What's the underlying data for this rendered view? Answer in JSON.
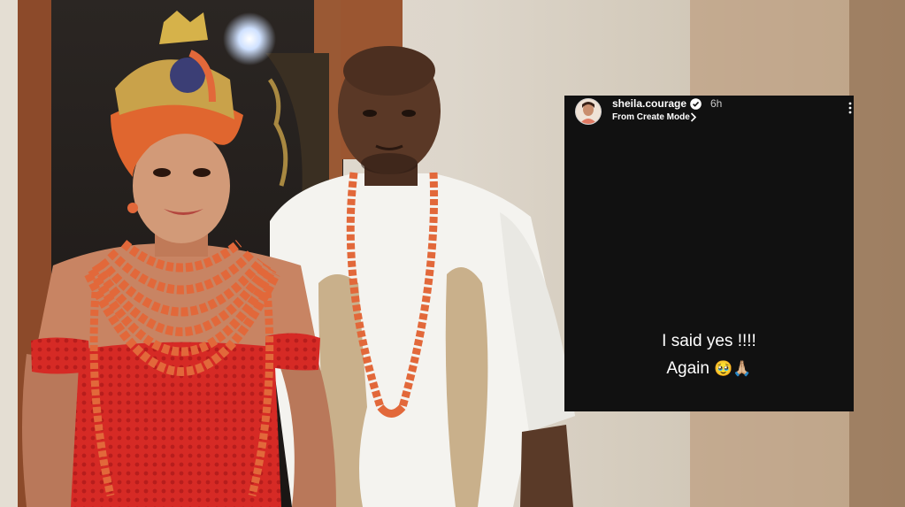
{
  "story": {
    "username": "sheila.courage",
    "time": "6h",
    "subtitle": "From Create Mode",
    "line1": "I said yes !!!!",
    "line2_text": "Again",
    "line2_emoji": "🥹🙏🏼"
  },
  "colors": {
    "story_background": "#111111",
    "coral_beads": "#e2683a",
    "dress_red": "#d62a25",
    "gele_orange": "#e0662f",
    "agbada_white": "#f4f3ef",
    "gold_embroidery": "#c9b08b",
    "wall": "#d9d3c8",
    "door_wood": "#8c4a2a"
  },
  "icons": [
    "verified-badge-icon",
    "chevron-right-icon",
    "more-options-icon"
  ]
}
